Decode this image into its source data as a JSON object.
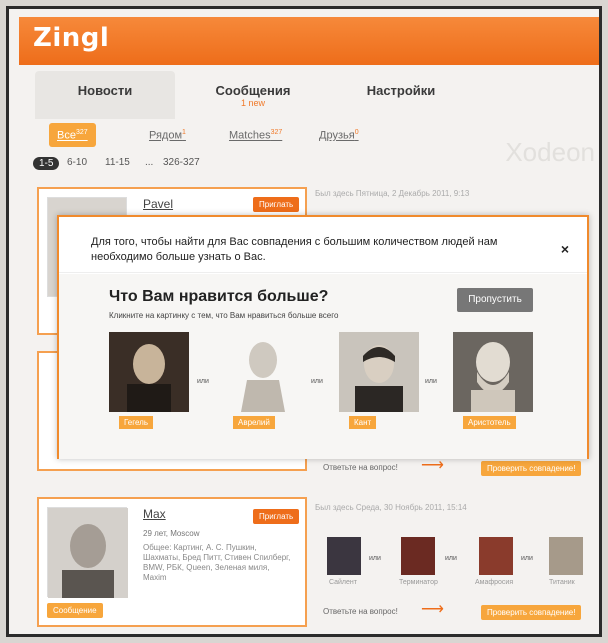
{
  "app": {
    "logo": "Zingl",
    "brand_color": "#ee6d1a"
  },
  "tabs": [
    {
      "label": "Новости",
      "sub": ""
    },
    {
      "label": "Сообщения",
      "sub": "1 new"
    },
    {
      "label": "Настройки",
      "sub": ""
    }
  ],
  "filters": [
    {
      "label": "Все",
      "count": "327"
    },
    {
      "label": "Рядом",
      "count": "1"
    },
    {
      "label": "Matches",
      "count": "327"
    },
    {
      "label": "Друзья",
      "count": "0"
    }
  ],
  "pager": {
    "items": [
      "1-5",
      "6-10",
      "11-15",
      "...",
      "326-327"
    ],
    "active": "1-5"
  },
  "background_title": "Xodeon",
  "cards": {
    "card1": {
      "name": "Pavel",
      "button": "Приглать",
      "visited": "Был здесь Пятница, 2 Декабрь 2011, 9:13"
    },
    "card2": {
      "answer": "Ответьте на вопрос!",
      "check_button": "Проверить совпадение!"
    },
    "card3": {
      "name": "Max",
      "button": "Приглать",
      "age_city": "29 лет, Moscow",
      "about": "Общее: Картинг, А. С. Пушкин, Шахматы, Бред Питт, Стивен Спилберг, BMW, РБК, Queen, Зеленая миля, Maxim",
      "message_button": "Сообщение",
      "visited": "Был здесь Среда, 30 Ноябрь 2011, 15:14",
      "mini_labels": [
        "Сайлент",
        "Терминатор",
        "Амафросия",
        "Титаник"
      ],
      "answer": "Ответьте на вопрос!",
      "check_button": "Проверить совпадение!"
    }
  },
  "modal": {
    "intro": "Для того, чтобы найти для Вас совпадения с большим количеством людей нам необходимо больше узнать о Вас.",
    "close": "×",
    "question": "Что Вам нравится больше?",
    "hint": "Кликните на картинку с тем, что Вам нравиться больше всего",
    "skip": "Пропустить",
    "or": "или",
    "choices": [
      {
        "label": "Гегель"
      },
      {
        "label": "Аврелий"
      },
      {
        "label": "Кант"
      },
      {
        "label": "Аристотель"
      }
    ]
  }
}
